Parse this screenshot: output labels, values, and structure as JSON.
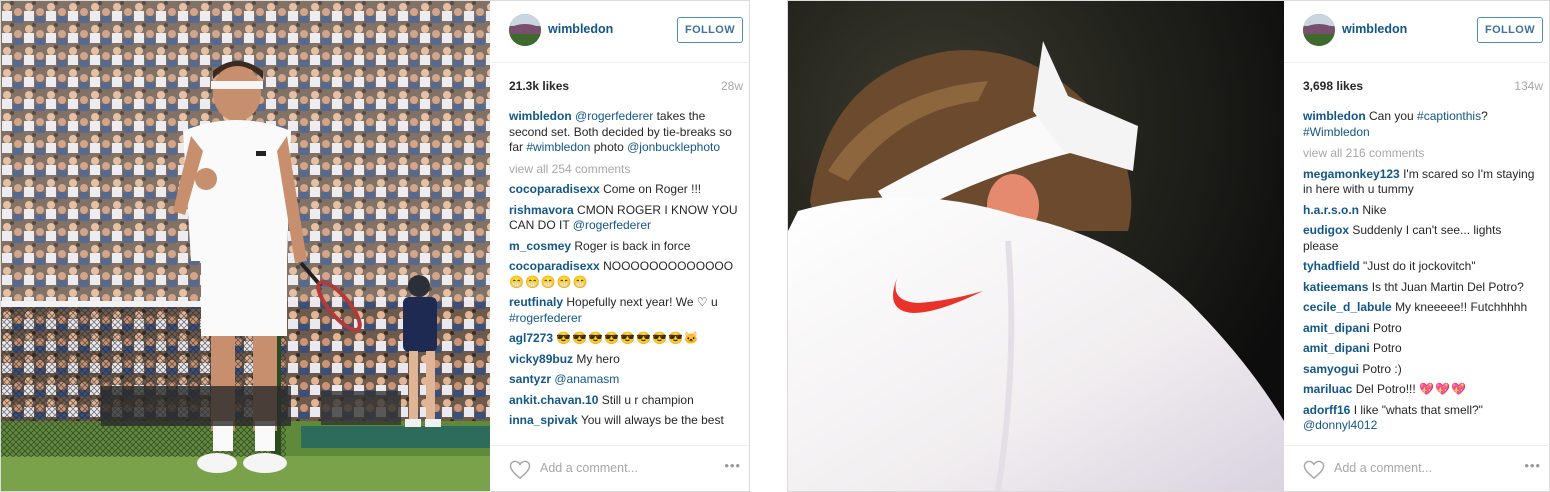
{
  "post1": {
    "username": "wimbledon",
    "follow_label": "FOLLOW",
    "likes": "21.3k likes",
    "age": "28w",
    "caption": {
      "user": "wimbledon",
      "mention": "@rogerfederer",
      "text1": " takes the second set. Both decided by tie-breaks so far ",
      "hashtag": "#wimbledon",
      "text2": " photo ",
      "credit": "@jonbucklephoto"
    },
    "view_all": "view all 254 comments",
    "comments": [
      {
        "user": "cocoparadisexx",
        "text": "Come on Roger !!!"
      },
      {
        "user": "rishmavora",
        "text": "CMON ROGER I KNOW YOU CAN DO IT",
        "tag": "@rogerfederer"
      },
      {
        "user": "m_cosmey",
        "text": "Roger is back in force"
      },
      {
        "user": "cocoparadisexx",
        "text": "NOOOOOOOOOOOOO",
        "emoji": "😁😁😁😁😁"
      },
      {
        "user": "reutfinaly",
        "text": "Hopefully next year! We ♡ u",
        "tag": "#rogerfederer"
      },
      {
        "user": "agl7273",
        "text": "",
        "emoji": "😎😎😎😎😎😎😎😎🐱"
      },
      {
        "user": "vicky89buz",
        "text": "My hero"
      },
      {
        "user": "santyzr",
        "text": "",
        "tag": "@anamasm"
      },
      {
        "user": "ankit.chavan.10",
        "text": "Still u r champion"
      },
      {
        "user": "inna_spivak",
        "text": "You will always be the best"
      }
    ],
    "add_comment": "Add a comment...",
    "more": "•••"
  },
  "post2": {
    "username": "wimbledon",
    "follow_label": "FOLLOW",
    "likes": "3,698 likes",
    "age": "134w",
    "caption": {
      "user": "wimbledon",
      "text1": " Can you ",
      "hashtag1": "#captionthis",
      "text2": "? ",
      "hashtag2": "#Wimbledon"
    },
    "view_all": "view all 216 comments",
    "comments": [
      {
        "user": "megamonkey123",
        "text": "I'm scared so I'm staying in here with u tummy"
      },
      {
        "user": "h.a.r.s.o.n",
        "text": "Nike"
      },
      {
        "user": "eudigox",
        "text": "Suddenly I can't see... lights please"
      },
      {
        "user": "tyhadfield",
        "text": "\"Just do it jockovitch\""
      },
      {
        "user": "katieemans",
        "text": "Is tht Juan Martin Del Potro?"
      },
      {
        "user": "cecile_d_labule",
        "text": "My kneeeee!! Futchhhhh"
      },
      {
        "user": "amit_dipani",
        "text": "Potro"
      },
      {
        "user": "amit_dipani",
        "text": "Potro"
      },
      {
        "user": "samyogui",
        "text": "Potro :)"
      },
      {
        "user": "mariluac",
        "text": "Del Potro!!!",
        "emoji": "💖💖💖"
      },
      {
        "user": "adorff16",
        "text": "I like \"whats that smell?\"",
        "tag": "@donnyl4012"
      }
    ],
    "add_comment": "Add a comment...",
    "more": "•••"
  },
  "colors": {
    "username_blue": "#125688",
    "follow_border": "#4a90c2",
    "muted_gray": "#a5a7aa",
    "nike_swoosh": "#e8322a"
  },
  "icons": [
    "heart-icon",
    "more-options-icon",
    "avatar-icon"
  ]
}
